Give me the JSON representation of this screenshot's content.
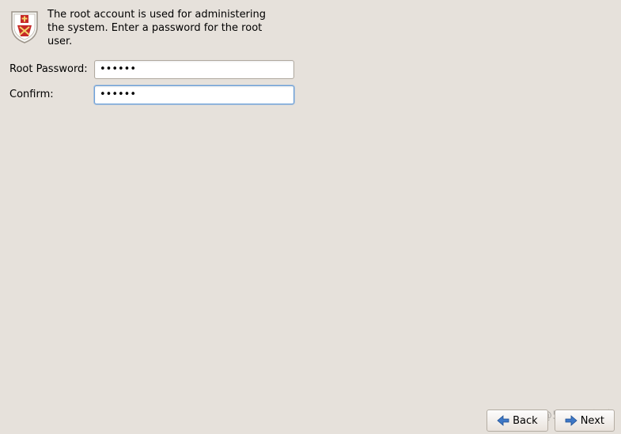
{
  "header": {
    "description": "The root account is used for administering the system.  Enter a password for the root user.",
    "icon_name": "shield-icon"
  },
  "form": {
    "root_password": {
      "label": "Root Password:",
      "value": "••••••"
    },
    "confirm": {
      "label": "Confirm:",
      "value": "••••••"
    }
  },
  "footer": {
    "back_label": "Back",
    "next_label": "Next"
  },
  "watermark": "@51CTO博客"
}
